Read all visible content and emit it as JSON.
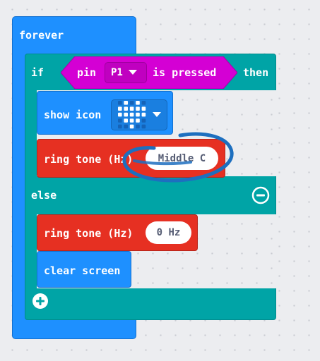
{
  "forever": {
    "label": "forever"
  },
  "if_block": {
    "if_label": "if",
    "then_label": "then",
    "else_label": "else",
    "condition": {
      "pin_label": "pin",
      "pin_value": "P1",
      "pressed_label": "is pressed"
    }
  },
  "show_icon": {
    "label": "show icon",
    "icon": "heart-icon"
  },
  "ring_tone_1": {
    "label": "ring tone (Hz)",
    "value": "Middle C"
  },
  "ring_tone_2": {
    "label": "ring tone (Hz)",
    "value": "0 Hz"
  },
  "clear_screen": {
    "label": "clear screen"
  },
  "colors": {
    "loops": "#1e90ff",
    "logic": "#00a4a6",
    "input": "#d400d4",
    "music": "#e63022",
    "annotation": "#1d6fbf"
  }
}
